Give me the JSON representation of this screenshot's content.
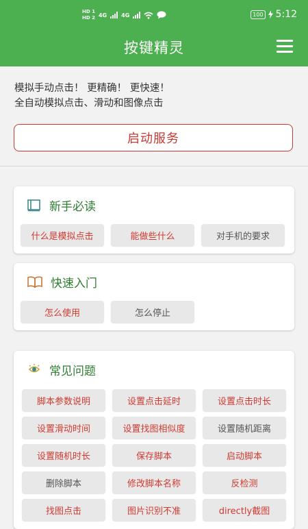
{
  "status_bar": {
    "hd1": "HD 1",
    "hd2": "HD 2",
    "net1": "4G",
    "net2": "4G",
    "battery": "100",
    "time": "5:12"
  },
  "app_bar": {
    "title": "按键精灵",
    "menu_icon": "hamburger-menu-icon"
  },
  "intro": {
    "line1": "模拟手动点击！ 更精确！ 更快速！",
    "line2": "全自动模拟点击、滑动和图像点击"
  },
  "start_button": "启动服务",
  "sections": [
    {
      "title": "新手必读",
      "icon": "book-icon",
      "title_color": "#2e7d32",
      "items": [
        {
          "label": "什么是模拟点击",
          "color": "red"
        },
        {
          "label": "能做些什么",
          "color": "red"
        },
        {
          "label": "对手机的要求",
          "color": "gray"
        }
      ]
    },
    {
      "title": "快速入门",
      "icon": "open-book-icon",
      "title_color": "#2e7d32",
      "items": [
        {
          "label": "怎么使用",
          "color": "red"
        },
        {
          "label": "怎么停止",
          "color": "gray"
        }
      ]
    },
    {
      "title": "常见问题",
      "icon": "lightbulb-icon",
      "title_color": "#2e7d32",
      "items": [
        {
          "label": "脚本参数说明",
          "color": "red"
        },
        {
          "label": "设置点击延时",
          "color": "red"
        },
        {
          "label": "设置点击时长",
          "color": "red"
        },
        {
          "label": "设置滑动时间",
          "color": "red"
        },
        {
          "label": "设置找图相似度",
          "color": "red"
        },
        {
          "label": "设置随机距离",
          "color": "gray"
        },
        {
          "label": "设置随机时长",
          "color": "red"
        },
        {
          "label": "保存脚本",
          "color": "red"
        },
        {
          "label": "启动脚本",
          "color": "red"
        },
        {
          "label": "删除脚本",
          "color": "gray"
        },
        {
          "label": "修改脚本名称",
          "color": "red"
        },
        {
          "label": "反检测",
          "color": "red"
        },
        {
          "label": "找图点击",
          "color": "red"
        },
        {
          "label": "图片识别不准",
          "color": "red"
        },
        {
          "label": "directly截图",
          "color": "red"
        }
      ]
    }
  ],
  "colors": {
    "primary": "#4caf50",
    "accent_red": "#d23a30",
    "section_title": "#2e7d32"
  }
}
